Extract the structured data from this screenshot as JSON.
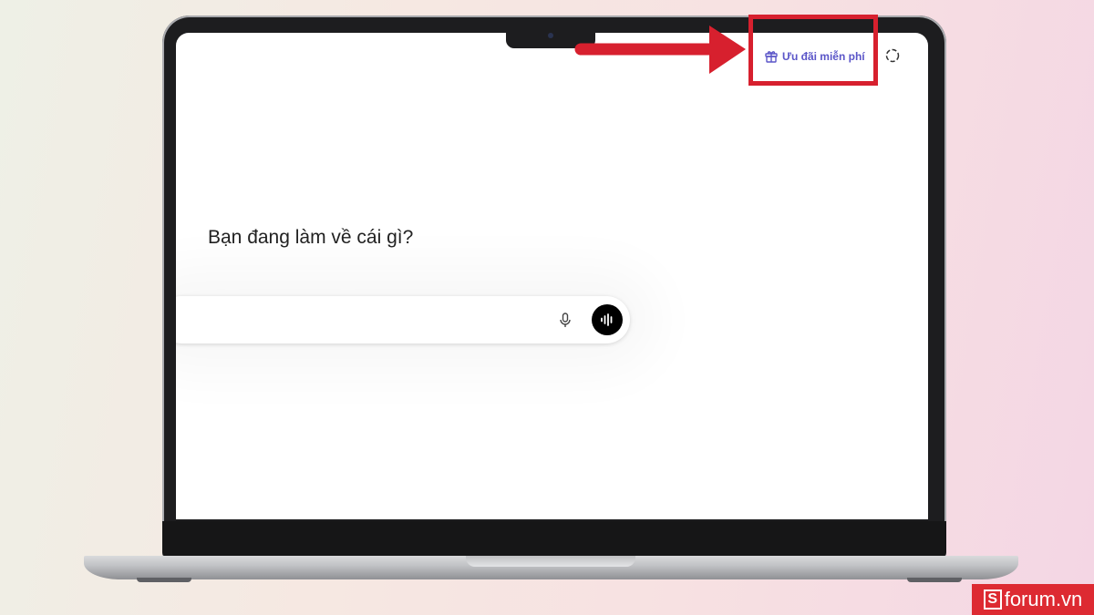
{
  "screen": {
    "promo_label": "Ưu đãi miễn phí",
    "heading": "Bạn đang làm về cái gì?",
    "composer": {
      "value": "",
      "mic_icon": "mic-icon",
      "voice_icon": "voice-mode-icon"
    },
    "promo_icon": "gift-icon",
    "extra_icon": "dashed-circle-icon"
  },
  "colors": {
    "accent": "#5a55c8",
    "annotation": "#d7202e"
  },
  "watermark": {
    "logo_letter": "S",
    "text": "forum.vn"
  }
}
